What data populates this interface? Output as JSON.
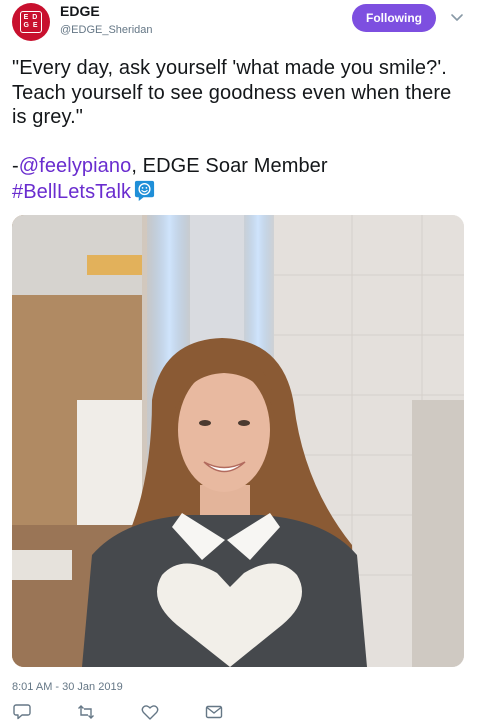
{
  "account": {
    "name": "EDGE",
    "handle": "@EDGE_Sheridan",
    "avatar_text": "E D\nG E",
    "avatar_color": "#c8102e"
  },
  "follow_button": {
    "label": "Following",
    "color": "#7d4fe0"
  },
  "tweet": {
    "quote": "\"Every day, ask yourself 'what made you smile?'. Teach yourself to see goodness even when there is grey.\"",
    "attribution_prefix": "-",
    "mention": "@feelypiano",
    "attribution_suffix": ", EDGE Soar Member",
    "hashtag": "#BellLetsTalk",
    "hashtag_emoji": "bell-lets-talk-emoji-icon",
    "link_color": "#6a2dcf"
  },
  "photo": {
    "icon": "photo-of-smiling-woman-in-heart-sweater"
  },
  "timestamp": "8:01 AM - 30 Jan 2019",
  "actions": [
    "reply-icon",
    "retweet-icon",
    "like-icon",
    "message-icon"
  ]
}
